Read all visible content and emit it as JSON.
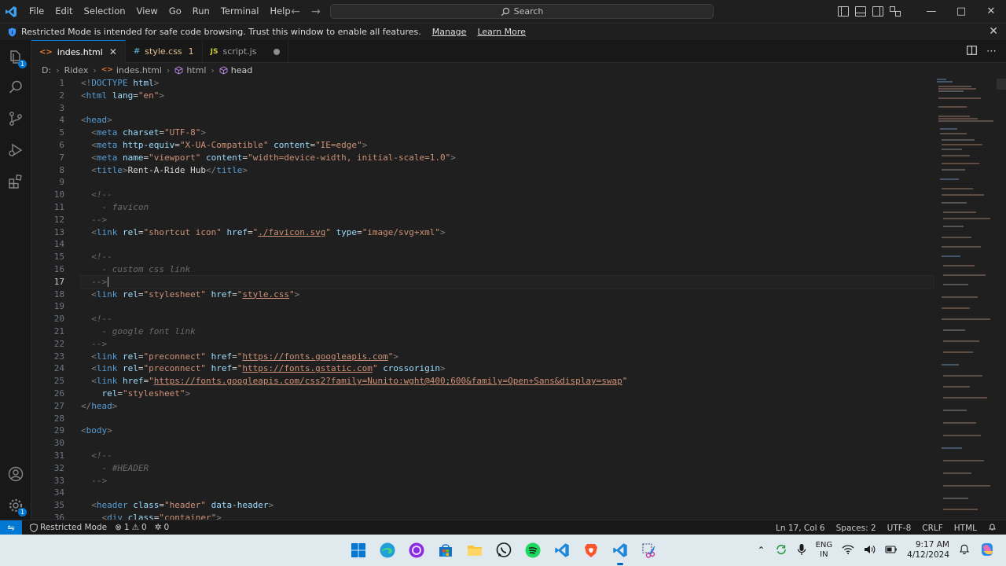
{
  "titlebar": {
    "menu": [
      "File",
      "Edit",
      "Selection",
      "View",
      "Go",
      "Run",
      "Terminal",
      "Help"
    ],
    "search_label": "Search"
  },
  "banner": {
    "message": "Restricted Mode is intended for safe code browsing. Trust this window to enable all features.",
    "manage": "Manage",
    "learn_more": "Learn More"
  },
  "activity": {
    "explorer_badge": "1",
    "manage_badge": "1"
  },
  "tabs": [
    {
      "icon": "<>",
      "label": "indes.html",
      "active": true
    },
    {
      "icon": "#",
      "label": "style.css",
      "error_count": "1"
    },
    {
      "icon": "JS",
      "label": "script.js"
    }
  ],
  "breadcrumb": {
    "drive": "D:",
    "folder": "Ridex",
    "file": "indes.html",
    "html": "html",
    "head": "head"
  },
  "editor": {
    "current_line": 17,
    "lines": [
      {
        "n": "1"
      },
      {
        "n": "2"
      },
      {
        "n": "3"
      },
      {
        "n": "4"
      },
      {
        "n": "5"
      },
      {
        "n": "6"
      },
      {
        "n": "7"
      },
      {
        "n": "8"
      },
      {
        "n": "9"
      },
      {
        "n": "10"
      },
      {
        "n": "11"
      },
      {
        "n": "12"
      },
      {
        "n": "13"
      },
      {
        "n": "14"
      },
      {
        "n": "15"
      },
      {
        "n": "16"
      },
      {
        "n": "17"
      },
      {
        "n": "18"
      },
      {
        "n": "19"
      },
      {
        "n": "20"
      },
      {
        "n": "21"
      },
      {
        "n": "22"
      },
      {
        "n": "23"
      },
      {
        "n": "24"
      },
      {
        "n": "25"
      },
      {
        "n": "26"
      },
      {
        "n": "27"
      },
      {
        "n": "28"
      },
      {
        "n": "29"
      },
      {
        "n": "30"
      },
      {
        "n": "31"
      },
      {
        "n": "32"
      },
      {
        "n": "33"
      },
      {
        "n": "34"
      },
      {
        "n": "35"
      },
      {
        "n": "36"
      }
    ],
    "code": {
      "l1_doctype": "DOCTYPE",
      "l1_html": "html",
      "l2_lang_val": "\"en\"",
      "l5_charset": "\"UTF-8\"",
      "l6_http": "\"X-UA-Compatible\"",
      "l6_content": "\"IE=edge\"",
      "l7_name": "\"viewport\"",
      "l7_content": "\"width=device-width, initial-scale=1.0\"",
      "l8_title": "Rent-A-Ride Hub",
      "l10": "<!--",
      "l11": "  - favicon",
      "l12": "-->",
      "l13_rel": "\"shortcut icon\"",
      "l13_href": "./favicon.svg",
      "l13_type": "\"image/svg+xml\"",
      "l16": "  - custom css link",
      "l18_rel": "\"stylesheet\"",
      "l18_href": "style.css",
      "l21": "  - google font link",
      "l23_rel": "\"preconnect\"",
      "l23_href": "https://fonts.googleapis.com",
      "l24_href": "https://fonts.gstatic.com",
      "l24_attr": "crossorigin",
      "l25_href": "https://fonts.googleapis.com/css2?family=Nunito:wght@400;600&family=Open+Sans&display=swap",
      "l26_rel": "\"stylesheet\"",
      "l32": "  - #HEADER",
      "l35_class": "\"header\"",
      "l35_data": "data-header",
      "l36_class": "\"container\""
    }
  },
  "statusbar": {
    "restricted": "Restricted Mode",
    "errors": "1",
    "warnings": "0",
    "ports": "0",
    "position": "Ln 17, Col 6",
    "spaces": "Spaces: 2",
    "encoding": "UTF-8",
    "eol": "CRLF",
    "language": "HTML"
  },
  "taskbar": {
    "lang_top": "ENG",
    "lang_bottom": "IN",
    "time": "9:17 AM",
    "date": "4/12/2024"
  },
  "colors": {
    "accent": "#0078d4",
    "editor_bg": "#1f1f1f",
    "taskbar_bg": "#dfe9ee"
  }
}
